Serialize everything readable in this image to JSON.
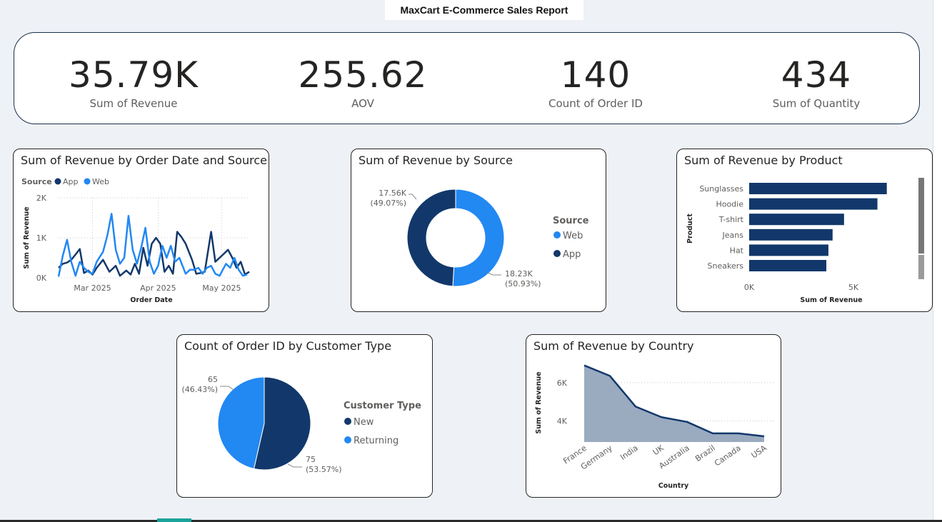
{
  "report": {
    "title": "MaxCart E-Commerce Sales Report"
  },
  "kpis": [
    {
      "value": "35.79K",
      "label": "Sum of Revenue"
    },
    {
      "value": "255.62",
      "label": "AOV"
    },
    {
      "value": "140",
      "label": "Count of Order ID"
    },
    {
      "value": "434",
      "label": "Sum of Quantity"
    }
  ],
  "cards": {
    "line": {
      "title": "Sum of Revenue by Order Date and Source"
    },
    "donut": {
      "title": "Sum of Revenue by Source"
    },
    "bar": {
      "title": "Sum of Revenue by Product"
    },
    "pie": {
      "title": "Count of Order ID by Customer Type"
    },
    "area": {
      "title": "Sum of Revenue by Country"
    }
  },
  "colors": {
    "dark": "#12386b",
    "light": "#2288f2",
    "area_fill": "#9aabc0"
  },
  "chart_data": [
    {
      "type": "line",
      "title": "Sum of Revenue by Order Date and Source",
      "xlabel": "Order Date",
      "ylabel": "Sum of Revenue",
      "legend_title": "Source",
      "legend_position": "top-left",
      "ylim": [
        0,
        2000
      ],
      "y_ticks": [
        "0K",
        "1K",
        "2K"
      ],
      "y_tick_values": [
        0,
        1000,
        2000
      ],
      "x_ticks": [
        "Mar 2025",
        "Apr 2025",
        "May 2025"
      ],
      "x_tick_values": [
        "2025-03-01",
        "2025-04-01",
        "2025-05-01"
      ],
      "grid": true,
      "series": [
        {
          "name": "App",
          "color": "#12386b",
          "points": [
            [
              "2025-02-13",
              250
            ],
            [
              "2025-02-15",
              350
            ],
            [
              "2025-02-17",
              380
            ],
            [
              "2025-02-19",
              450
            ],
            [
              "2025-02-21",
              580
            ],
            [
              "2025-02-23",
              720
            ],
            [
              "2025-02-25",
              120
            ],
            [
              "2025-02-27",
              180
            ],
            [
              "2025-03-01",
              80
            ],
            [
              "2025-03-03",
              250
            ],
            [
              "2025-03-06",
              450
            ],
            [
              "2025-03-09",
              150
            ],
            [
              "2025-03-12",
              300
            ],
            [
              "2025-03-14",
              50
            ],
            [
              "2025-03-17",
              180
            ],
            [
              "2025-03-19",
              80
            ],
            [
              "2025-03-21",
              350
            ],
            [
              "2025-03-23",
              100
            ],
            [
              "2025-03-25",
              750
            ],
            [
              "2025-03-27",
              300
            ],
            [
              "2025-03-29",
              850
            ],
            [
              "2025-03-31",
              1000
            ],
            [
              "2025-04-02",
              850
            ],
            [
              "2025-04-04",
              150
            ],
            [
              "2025-04-06",
              300
            ],
            [
              "2025-04-08",
              100
            ],
            [
              "2025-04-10",
              1150
            ],
            [
              "2025-04-12",
              1020
            ],
            [
              "2025-04-14",
              850
            ],
            [
              "2025-04-17",
              450
            ],
            [
              "2025-04-19",
              100
            ],
            [
              "2025-04-21",
              120
            ],
            [
              "2025-04-23",
              150
            ],
            [
              "2025-04-26",
              1150
            ],
            [
              "2025-04-28",
              400
            ],
            [
              "2025-04-30",
              500
            ],
            [
              "2025-05-02",
              600
            ],
            [
              "2025-05-04",
              700
            ],
            [
              "2025-05-06",
              500
            ],
            [
              "2025-05-08",
              250
            ],
            [
              "2025-05-10",
              400
            ],
            [
              "2025-05-12",
              80
            ],
            [
              "2025-05-14",
              150
            ]
          ]
        },
        {
          "name": "Web",
          "color": "#2288f2",
          "points": [
            [
              "2025-02-13",
              30
            ],
            [
              "2025-02-15",
              550
            ],
            [
              "2025-02-17",
              950
            ],
            [
              "2025-02-19",
              400
            ],
            [
              "2025-02-21",
              50
            ],
            [
              "2025-02-23",
              400
            ],
            [
              "2025-02-25",
              250
            ],
            [
              "2025-02-27",
              150
            ],
            [
              "2025-03-01",
              100
            ],
            [
              "2025-03-03",
              400
            ],
            [
              "2025-03-06",
              650
            ],
            [
              "2025-03-08",
              1050
            ],
            [
              "2025-03-10",
              1600
            ],
            [
              "2025-03-12",
              700
            ],
            [
              "2025-03-14",
              350
            ],
            [
              "2025-03-16",
              500
            ],
            [
              "2025-03-18",
              1550
            ],
            [
              "2025-03-20",
              700
            ],
            [
              "2025-03-22",
              350
            ],
            [
              "2025-03-24",
              750
            ],
            [
              "2025-03-26",
              1250
            ],
            [
              "2025-03-28",
              400
            ],
            [
              "2025-03-30",
              100
            ],
            [
              "2025-04-01",
              300
            ],
            [
              "2025-04-03",
              800
            ],
            [
              "2025-04-05",
              500
            ],
            [
              "2025-04-07",
              800
            ],
            [
              "2025-04-09",
              400
            ],
            [
              "2025-04-11",
              500
            ],
            [
              "2025-04-14",
              100
            ],
            [
              "2025-04-16",
              200
            ],
            [
              "2025-04-18",
              200
            ],
            [
              "2025-04-20",
              250
            ],
            [
              "2025-04-22",
              100
            ],
            [
              "2025-04-24",
              250
            ],
            [
              "2025-04-26",
              300
            ],
            [
              "2025-04-28",
              100
            ],
            [
              "2025-04-30",
              50
            ],
            [
              "2025-05-03",
              350
            ],
            [
              "2025-05-05",
              250
            ],
            [
              "2025-05-07",
              500
            ],
            [
              "2025-05-09",
              200
            ],
            [
              "2025-05-11",
              50
            ],
            [
              "2025-05-13",
              80
            ]
          ]
        }
      ]
    },
    {
      "type": "pie",
      "donut": true,
      "title": "Sum of Revenue by Source",
      "legend_title": "Source",
      "legend_position": "right",
      "slices": [
        {
          "name": "Web",
          "value": 18230,
          "label": "18.23K",
          "pct": "(50.93%)",
          "color": "#2288f2"
        },
        {
          "name": "App",
          "value": 17560,
          "label": "17.56K",
          "pct": "(49.07%)",
          "color": "#12386b"
        }
      ]
    },
    {
      "type": "bar",
      "orientation": "horizontal",
      "title": "Sum of Revenue by Product",
      "xlabel": "Sum of Revenue",
      "ylabel": "Product",
      "xlim": [
        0,
        7500
      ],
      "x_ticks": [
        "0K",
        "5K"
      ],
      "x_tick_values": [
        0,
        5000
      ],
      "categories": [
        "Sunglasses",
        "Hoodie",
        "T-shirt",
        "Jeans",
        "Hat",
        "Sneakers"
      ],
      "values": [
        6600,
        6150,
        4550,
        4000,
        3800,
        3700
      ],
      "color": "#12386b"
    },
    {
      "type": "pie",
      "title": "Count of Order ID by Customer Type",
      "legend_title": "Customer Type",
      "legend_position": "right",
      "slices": [
        {
          "name": "New",
          "value": 75,
          "label": "75",
          "pct": "(53.57%)",
          "color": "#12386b"
        },
        {
          "name": "Returning",
          "value": 65,
          "label": "65",
          "pct": "(46.43%)",
          "color": "#2288f2"
        }
      ]
    },
    {
      "type": "area",
      "title": "Sum of Revenue by Country",
      "xlabel": "Country",
      "ylabel": "Sum of Revenue",
      "ylim": [
        2900,
        7000
      ],
      "y_ticks": [
        "4K",
        "6K"
      ],
      "y_tick_values": [
        4000,
        6000
      ],
      "grid": true,
      "categories": [
        "France",
        "Germany",
        "India",
        "UK",
        "Australia",
        "Brazil",
        "Canada",
        "USA"
      ],
      "values": [
        6900,
        6350,
        4750,
        4200,
        3950,
        3350,
        3350,
        3200
      ],
      "color": "#12386b",
      "fill": "#9aabc0"
    }
  ]
}
